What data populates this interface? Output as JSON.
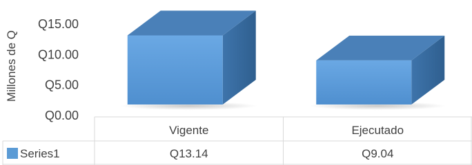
{
  "chart_data": {
    "type": "bar",
    "style": "3d-column-with-data-table",
    "categories": [
      "Vigente",
      "Ejecutado"
    ],
    "series": [
      {
        "name": "Series1",
        "values": [
          13.14,
          9.04
        ],
        "value_labels": [
          "Q13.14",
          "Q9.04"
        ],
        "color": "#5b9bd5"
      }
    ],
    "ylabel": "Millones de Q",
    "ylim": [
      0,
      15
    ],
    "y_ticks": [
      {
        "value": 0,
        "label": "Q0.00"
      },
      {
        "value": 5,
        "label": "Q5.00"
      },
      {
        "value": 10,
        "label": "Q10.00"
      },
      {
        "value": 15,
        "label": "Q15.00"
      }
    ],
    "grid": false,
    "legend": "data-table"
  }
}
